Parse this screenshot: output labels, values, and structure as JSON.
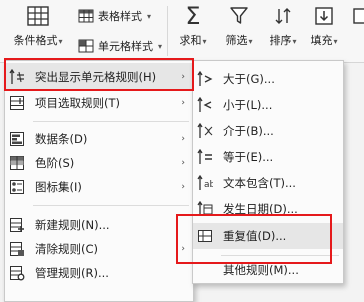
{
  "ribbon": {
    "conditional_format_label": "条件格式",
    "table_style_label": "表格样式",
    "cell_style_label": "单元格样式",
    "sum_label": "求和",
    "filter_label": "筛选",
    "sort_label": "排序",
    "fill_label": "填充"
  },
  "main_menu": {
    "items": [
      {
        "label": "突出显示单元格规则(H)",
        "icon": "highlight-rules-icon",
        "submenu": true
      },
      {
        "label": "项目选取规则(T)",
        "icon": "top-bottom-rules-icon",
        "submenu": true
      },
      {
        "label": "数据条(D)",
        "icon": "data-bars-icon",
        "submenu": true
      },
      {
        "label": "色阶(S)",
        "icon": "color-scales-icon",
        "submenu": true
      },
      {
        "label": "图标集(I)",
        "icon": "icon-sets-icon",
        "submenu": true
      },
      {
        "label": "新建规则(N)...",
        "icon": "new-rule-icon"
      },
      {
        "label": "清除规则(C)",
        "icon": "clear-rules-icon",
        "submenu": true
      },
      {
        "label": "管理规则(R)...",
        "icon": "manage-rules-icon"
      }
    ]
  },
  "sub_menu": {
    "items": [
      {
        "label": "大于(G)...",
        "icon": "greater-than-icon"
      },
      {
        "label": "小于(L)...",
        "icon": "less-than-icon"
      },
      {
        "label": "介于(B)...",
        "icon": "between-icon"
      },
      {
        "label": "等于(E)...",
        "icon": "equal-to-icon"
      },
      {
        "label": "文本包含(T)...",
        "icon": "text-contains-icon"
      },
      {
        "label": "发生日期(D)...",
        "icon": "date-occurring-icon"
      },
      {
        "label": "重复值(D)...",
        "icon": "duplicate-values-icon"
      },
      {
        "label": "其他规则(M)...",
        "icon": ""
      }
    ]
  },
  "colors": {
    "highlight_box": "#e5191b",
    "hover": "#e6e6e6"
  }
}
